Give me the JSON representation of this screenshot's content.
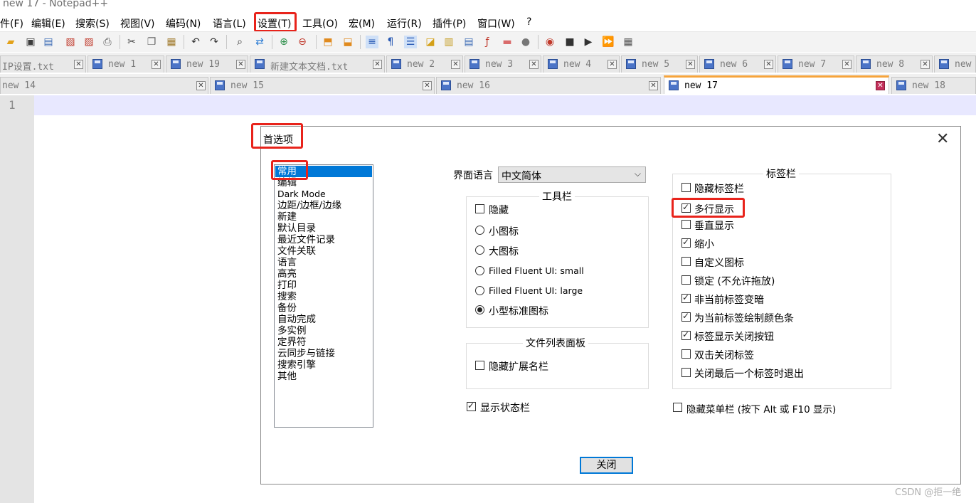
{
  "window": {
    "title": "new 17 - Notepad++"
  },
  "menu": [
    "件(F)",
    "编辑(E)",
    "搜索(S)",
    "视图(V)",
    "编码(N)",
    "语言(L)",
    "设置(T)",
    "工具(O)",
    "宏(M)",
    "运行(R)",
    "插件(P)",
    "窗口(W)",
    "?"
  ],
  "toolbar_icons": [
    "new-file-icon",
    "open-file-icon",
    "save-icon",
    "save-all-icon",
    "close-icon",
    "close-all-icon",
    "print-icon",
    "cut-icon",
    "copy-icon",
    "paste-icon",
    "undo-icon",
    "redo-icon",
    "find-icon",
    "replace-icon",
    "zoom-in-icon",
    "zoom-out-icon",
    "sync-v-icon",
    "sync-h-icon",
    "word-wrap-icon",
    "show-all-chars-icon",
    "indent-guide-icon",
    "udl-icon",
    "doc-map-icon",
    "doc-list-icon",
    "function-list-icon",
    "folder-workspace-icon",
    "monitor-icon",
    "record-macro-icon",
    "stop-macro-icon",
    "play-macro-icon",
    "run-macro-multiple-icon",
    "save-macro-icon"
  ],
  "tabs_row1": [
    {
      "label": "IP设置.txt"
    },
    {
      "label": "new 1"
    },
    {
      "label": "new 19"
    },
    {
      "label": "新建文本文档.txt"
    },
    {
      "label": "new 2"
    },
    {
      "label": "new 3"
    },
    {
      "label": "new 4"
    },
    {
      "label": "new 5"
    },
    {
      "label": "new 6"
    },
    {
      "label": "new 7"
    },
    {
      "label": "new 8"
    },
    {
      "label": "new"
    }
  ],
  "tabs_row2": [
    {
      "label": "new 14"
    },
    {
      "label": "new 15"
    },
    {
      "label": "new 16"
    },
    {
      "label": "new 17",
      "active": true
    },
    {
      "label": "new 18"
    }
  ],
  "editor": {
    "line_number": "1"
  },
  "dialog": {
    "title": "首选项",
    "close_glyph": "✕",
    "categories": [
      "常用",
      "编辑",
      "Dark Mode",
      "边距/边框/边缘",
      "新建",
      "默认目录",
      "最近文件记录",
      "文件关联",
      "语言",
      "高亮",
      "打印",
      "搜索",
      "备份",
      "自动完成",
      "多实例",
      "定界符",
      "云同步与链接",
      "搜索引擎",
      "其他"
    ],
    "selected_category": "常用",
    "ui_language": {
      "label": "界面语言",
      "value": "中文简体"
    },
    "toolbar_group": {
      "title": "工具栏",
      "hide_label": "隐藏",
      "hide_checked": false,
      "options": [
        {
          "label": "小图标",
          "checked": false
        },
        {
          "label": "大图标",
          "checked": false
        },
        {
          "label": "Filled Fluent UI: small",
          "checked": false
        },
        {
          "label": "Filled Fluent UI: large",
          "checked": false
        },
        {
          "label": "小型标准图标",
          "checked": true
        }
      ]
    },
    "doclist_group": {
      "title": "文件列表面板",
      "hide_ext_label": "隐藏扩展名栏",
      "hide_ext_checked": false
    },
    "statusbar": {
      "label": "显示状态栏",
      "checked": true
    },
    "tabbar_group": {
      "title": "标签栏",
      "options": [
        {
          "label": "隐藏标签栏",
          "checked": false
        },
        {
          "label": "多行显示",
          "checked": true
        },
        {
          "label": "垂直显示",
          "checked": false
        },
        {
          "label": "缩小",
          "checked": true
        },
        {
          "label": "自定义图标",
          "checked": false
        },
        {
          "label": "锁定 (不允许拖放)",
          "checked": false
        },
        {
          "label": "非当前标签变暗",
          "checked": true
        },
        {
          "label": "为当前标签绘制颜色条",
          "checked": true
        },
        {
          "label": "标签显示关闭按钮",
          "checked": true
        },
        {
          "label": "双击关闭标签",
          "checked": false
        },
        {
          "label": "关闭最后一个标签时退出",
          "checked": false
        }
      ]
    },
    "hide_menubar": {
      "label": "隐藏菜单栏 (按下 Alt 或 F10 显示)",
      "checked": false
    },
    "close_button": "关闭"
  },
  "watermark": "CSDN @拒一绝",
  "colors": {
    "highlight_red": "#e8231b",
    "selection_blue": "#0078d7",
    "active_tab_accent": "#f6a43b"
  }
}
